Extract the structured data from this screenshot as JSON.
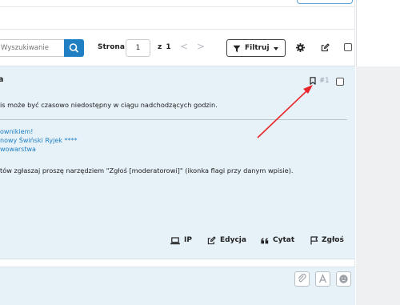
{
  "search": {
    "placeholder": "Wyszukiwanie"
  },
  "toolbar": {
    "page_label": "Strona",
    "page_value": "1",
    "of_label": "z 1",
    "prev": "<",
    "next": ">",
    "filter_label": "Filtruj"
  },
  "post": {
    "author_fragment": "a",
    "number": "#1",
    "line1": "is może być czasowo niedostępny w ciągu nadchodzących godzin.",
    "signature": [
      "ownikiem!",
      "nowy Świński Ryjek ****",
      "wowarstwa"
    ],
    "line2": "tów zgłaszaj proszę narzędziem \"Zgłoś [moderatorowi]\" (ikonka flagi przy danym wpisie).",
    "actions": {
      "ip": "IP",
      "edit": "Edycja",
      "quote": "Cytat",
      "report": "Zgłoś"
    }
  },
  "colors": {
    "accent": "#1f7fc2",
    "post_bg": "#e6f1f8",
    "arrow": "#e8262a"
  }
}
